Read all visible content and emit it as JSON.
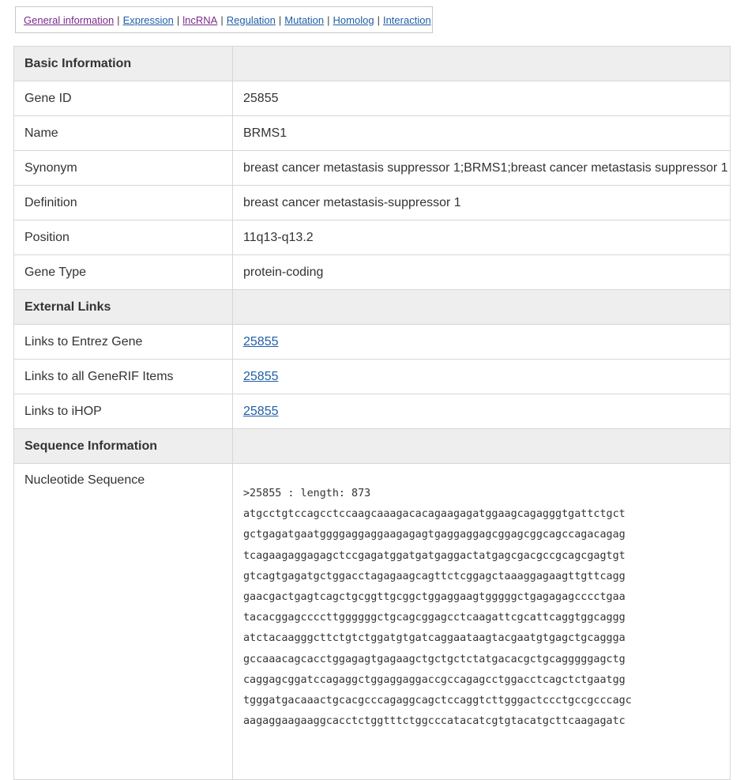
{
  "nav": {
    "items": [
      {
        "label": "General information",
        "visited": true
      },
      {
        "label": "Expression",
        "visited": false
      },
      {
        "label": "lncRNA",
        "visited": true
      },
      {
        "label": "Regulation",
        "visited": false
      },
      {
        "label": "Mutation",
        "visited": false
      },
      {
        "label": "Homolog",
        "visited": false
      },
      {
        "label": "Interaction",
        "visited": false
      }
    ],
    "separator": "|"
  },
  "basic": {
    "header": "Basic Information",
    "rows": [
      {
        "label": "Gene ID",
        "value": "25855"
      },
      {
        "label": "Name",
        "value": "BRMS1"
      },
      {
        "label": "Synonym",
        "value": "breast cancer metastasis suppressor 1;BRMS1;breast cancer metastasis suppressor 1"
      },
      {
        "label": "Definition",
        "value": "breast cancer metastasis-suppressor 1"
      },
      {
        "label": "Position",
        "value": "11q13-q13.2"
      },
      {
        "label": "Gene Type",
        "value": "protein-coding"
      }
    ]
  },
  "external": {
    "header": "External Links",
    "rows": [
      {
        "label": "Links to Entrez Gene",
        "link": "25855"
      },
      {
        "label": "Links to all GeneRIF Items",
        "link": "25855"
      },
      {
        "label": "Links to iHOP",
        "link": "25855"
      }
    ]
  },
  "sequence": {
    "header": "Sequence Information",
    "label": "Nucleotide Sequence",
    "fasta_header": ">25855 : length: 873",
    "lines": [
      "atgcctgtccagcctccaagcaaagacacagaagagatggaagcagagggtgattctgct",
      "gctgagatgaatggggaggaggaagagagtgaggaggagcggagcggcagccagacagag",
      "tcagaagaggagagctccgagatggatgatgaggactatgagcgacgccgcagcgagtgt",
      "gtcagtgagatgctggacctagagaagcagttctcggagctaaaggagaagttgttcagg",
      "gaacgactgagtcagctgcggttgcggctggaggaagtgggggctgagagagcccctgaa",
      "tacacggagccccttggggggctgcagcggagcctcaagattcgcattcaggtggcaggg",
      "atctacaagggcttctgtctggatgtgatcaggaataagtacgaatgtgagctgcaggga",
      "gccaaacagcacctggagagtgagaagctgctgctctatgacacgctgcagggggagctg",
      "caggagcggatccagaggctggaggaggaccgccagagcctggacctcagctctgaatgg",
      "tgggatgacaaactgcacgcccagaggcagctccaggtcttgggactccctgccgcccagc",
      "aagaggaagaaggcacctctggtttctggcccatacatcgtgtacatgcttcaagagatc"
    ]
  }
}
